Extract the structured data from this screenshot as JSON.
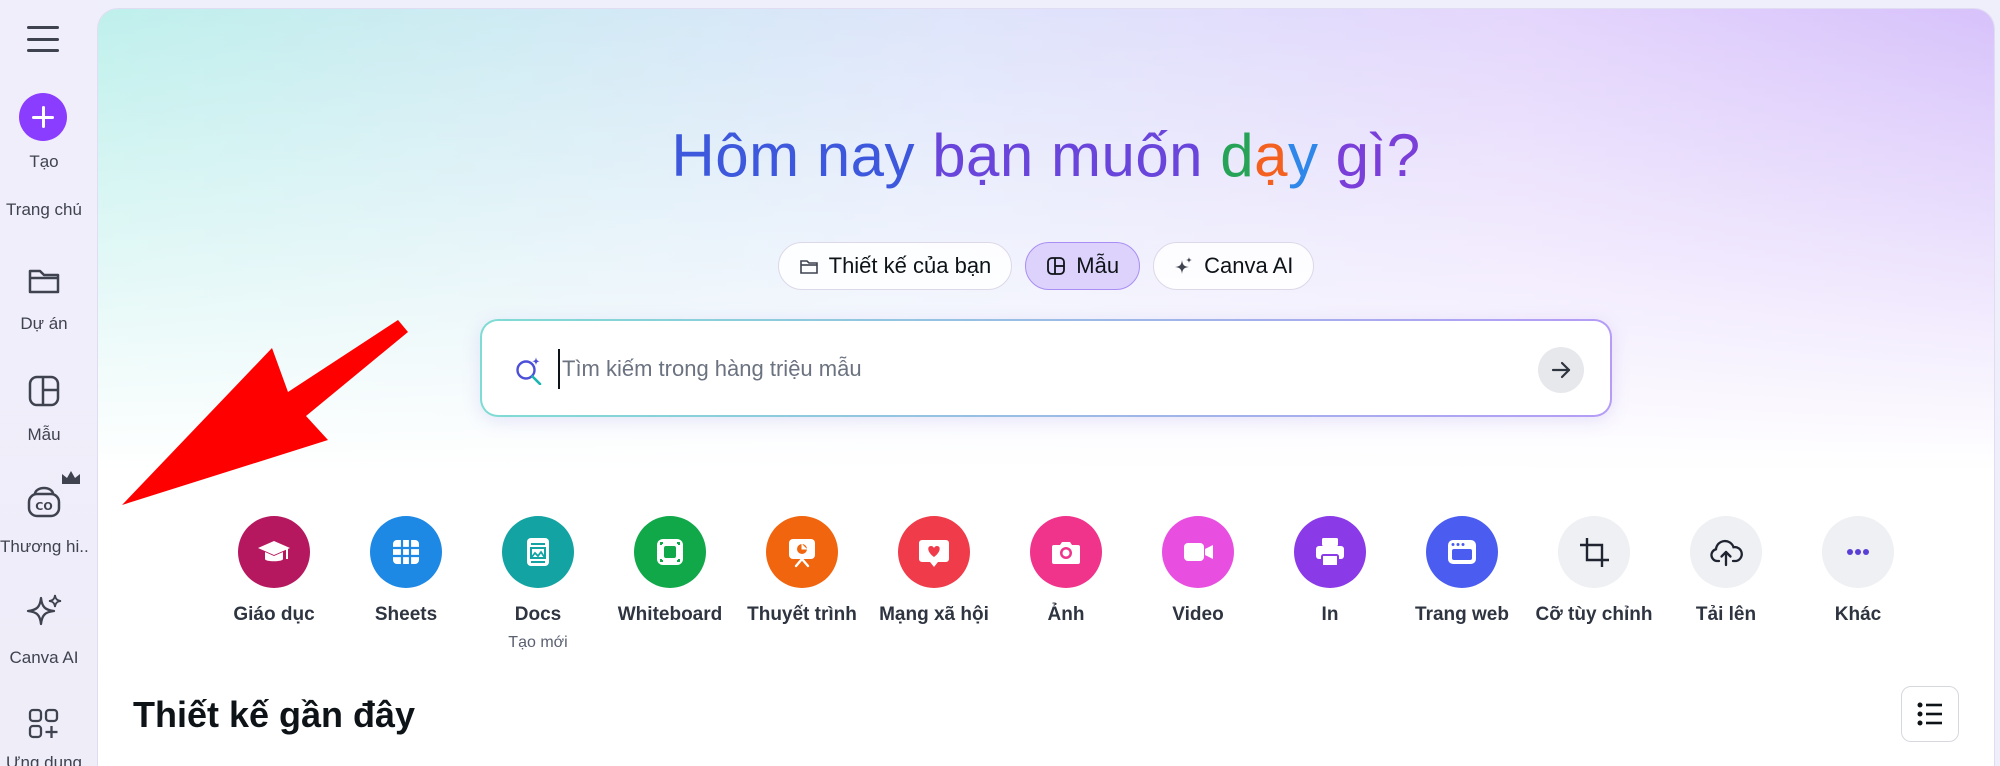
{
  "sidebar": {
    "create_label": "Tạo",
    "items": [
      {
        "label": "Trang chủ",
        "icon": "home-icon"
      },
      {
        "label": "Dự án",
        "icon": "folder-icon"
      },
      {
        "label": "Mẫu",
        "icon": "template-icon"
      },
      {
        "label": "Thương hi...",
        "icon": "brand-icon"
      },
      {
        "label": "Canva AI",
        "icon": "sparkle-icon"
      },
      {
        "label": "Ứng dụng",
        "icon": "apps-icon"
      }
    ]
  },
  "hero": {
    "part1": "Hôm nay ",
    "part2": "bạn muốn ",
    "d": "d",
    "a": "ạ",
    "y": "y",
    "rest": " gì?"
  },
  "tabs": [
    {
      "label": "Thiết kế của bạn",
      "icon": "folder-icon"
    },
    {
      "label": "Mẫu",
      "icon": "template-icon",
      "active": true
    },
    {
      "label": "Canva AI",
      "icon": "sparkle-icon"
    }
  ],
  "search": {
    "placeholder": "Tìm kiếm trong hàng triệu mẫu"
  },
  "categories": [
    {
      "label": "Giáo dục",
      "color": "#b5185f",
      "icon": "graduation-cap-icon"
    },
    {
      "label": "Sheets",
      "color": "#1e88e5",
      "icon": "sheet-icon"
    },
    {
      "label": "Docs",
      "color": "#13a3a3",
      "icon": "doc-icon",
      "sub": "Tạo mới"
    },
    {
      "label": "Whiteboard",
      "color": "#11a84a",
      "icon": "whiteboard-icon"
    },
    {
      "label": "Thuyết trình",
      "color": "#f0650e",
      "icon": "presentation-icon"
    },
    {
      "label": "Mạng xã hội",
      "color": "#ef3b4a",
      "icon": "heart-chat-icon"
    },
    {
      "label": "Ảnh",
      "color": "#f0338b",
      "icon": "camera-icon"
    },
    {
      "label": "Video",
      "color": "#e84fe0",
      "icon": "video-icon"
    },
    {
      "label": "In",
      "color": "#8b3ae8",
      "icon": "printer-icon"
    },
    {
      "label": "Trang web",
      "color": "#4a5df0",
      "icon": "website-icon"
    },
    {
      "label": "Cỡ tùy chỉnh",
      "color": "#eef0f3",
      "icon": "crop-icon"
    },
    {
      "label": "Tải lên",
      "color": "#eef0f3",
      "icon": "cloud-upload-icon"
    },
    {
      "label": "Khác",
      "color": "#eef0f3",
      "icon": "more-icon"
    }
  ],
  "recent": {
    "title": "Thiết kế gần đây"
  },
  "colors": {
    "accent": "#8b3dff",
    "arrow": "#ff0000"
  }
}
